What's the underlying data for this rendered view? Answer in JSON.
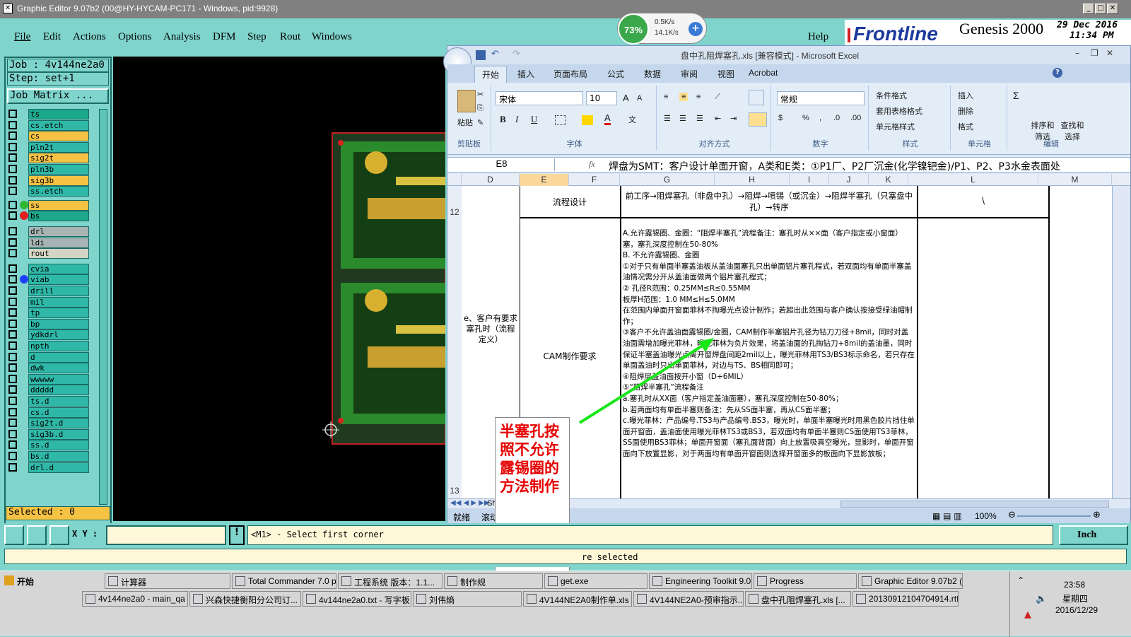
{
  "window": {
    "title": "Graphic Editor 9.07b2 (00@HY-HYCAM-PC171 - Windows, pid:9928)"
  },
  "menu": {
    "items": [
      "File",
      "Edit",
      "Actions",
      "Options",
      "Analysis",
      "DFM",
      "Step",
      "Rout",
      "Windows"
    ],
    "help": "Help"
  },
  "net": {
    "percent": "73%",
    "up": "0.5K/s",
    "down": "14.1K/s"
  },
  "brand": {
    "logo": "Frontline",
    "product": "Genesis 2000",
    "date": "29 Dec 2016",
    "time": "11:34 PM"
  },
  "job": {
    "name": "Job : 4v144ne2a0",
    "step": "Step: set+1",
    "matrix": "Job Matrix ...",
    "selected": "Selected : 0"
  },
  "layers": [
    "ts",
    "cs.etch",
    "cs",
    "pln2t",
    "sig2t",
    "pln3b",
    "sig3b",
    "ss.etch",
    "ss",
    "bs",
    "drl",
    "ldi",
    "rout",
    "cvia",
    "viab",
    "drill",
    "mil",
    "tp",
    "bp",
    "ydkdrl",
    "npth",
    "d",
    "dwk",
    "wwwww",
    "ddddd",
    "ts.d",
    "cs.d",
    "sig2t.d",
    "sig3b.d",
    "ss.d",
    "bs.d",
    "drl.d"
  ],
  "layer_colors": {
    "ts": "#1ca88a",
    "cs.etch": "#2fb8a8",
    "cs": "#f6c244",
    "pln2t": "#2fb8a8",
    "sig2t": "#f6c244",
    "pln3b": "#2fb8a8",
    "sig3b": "#f6c244",
    "ss.etch": "#2fb8a8",
    "ss": "#f6c244",
    "bs": "#1ca88a",
    "drl": "#a8b4b4",
    "ldi": "#a8b4b4",
    "rout": "#d4d4c4"
  },
  "excel": {
    "title": "盘中孔阻焊塞孔.xls [兼容模式] - Microsoft Excel",
    "tabs": [
      "开始",
      "插入",
      "页面布局",
      "公式",
      "数据",
      "审阅",
      "视图",
      "Acrobat"
    ],
    "groups": [
      "剪贴板",
      "字体",
      "对齐方式",
      "数字",
      "样式",
      "单元格",
      "编辑"
    ],
    "paste": "粘贴",
    "font_name": "宋体",
    "font_size": "10",
    "number_format": "常规",
    "style_buttons": [
      "条件格式",
      "套用表格格式",
      "单元格样式"
    ],
    "cell_buttons": [
      "插入",
      "删除",
      "格式"
    ],
    "edit_buttons": [
      "排序和筛选",
      "查找和选择"
    ],
    "name_box": "E8",
    "fx": "fx",
    "formula": "焊盘为SMT：客户设计单面开窗，A类和E类：①P1厂、P2厂沉金(化学镍钯金)/P1、P2、P3水金表面处",
    "columns": [
      "D",
      "E",
      "F",
      "G",
      "H",
      "I",
      "J",
      "K",
      "L",
      "M"
    ],
    "rows": [
      "12",
      "13"
    ],
    "row12_label": "流程设计",
    "row12_flow": "前工序→阻焊塞孔（非盘中孔）→阻焊→喷锡（或沉金）→阻焊半塞孔（只塞盘中孔）→转序",
    "row12_l": "\\",
    "row13_category": "e、客户有要求塞孔时（流程定义）",
    "row13_label": "CAM制作要求",
    "row13_text": [
      "A.允许露锡圈、金圈：“阻焊半塞孔”流程备注：塞孔时从××面（客户指定或小窗面）塞，塞孔深度控制在50-80%",
      "B. 不允许露锡圈、金圈",
      "①对于只有单面半塞盖油板从盖油面塞孔只出单面铝片塞孔程式，若双面均有单面半塞盖油情况需分开从盖油面做两个铝片塞孔程式；",
      "②  孔径R范围：0.25MM≤R≤0.55MM",
      "    板厚H范围：1.0 MM≤H≤5.0MM",
      "在范围内单面开窗面菲林不掏曝光点设计制作；若超出此范围与客户确认按接受绿油帽制作；",
      "③客户不允许盖油面露锡圈/金圈，CAM制作半塞铝片孔径为钻刀刀径+8mil，同时对盖油面需增加曝光菲林，曝光菲林为负片效果，将盖油面的孔掏钻刀+8mil的盖油墨，同时保证半塞盖油曝光点离开窗焊盘间距2mil以上，曝光菲林用TS3/BS3标示命名，若只存在单面盖油时只出单面菲林，对边与TS、BS相同即可；",
      "④阻焊层盖油面按开小窗（D+6MIL）",
      "⑤“阻焊半塞孔”流程备注",
      "a.塞孔时从XX面（客户指定盖油面塞），塞孔深度控制在50-80%；",
      "b.若两面均有单面半塞则备注：先从SS面半塞，再从CS面半塞；",
      "c.曝光菲林：产品编号.TS3与产品编号.BS3，曝光时，单面半塞曝光时用黑色胶片挡住单面开窗面，盖油面使用曝光菲林TS3或BS3，若双面均有单面半塞则CS面使用TS3菲林，SS面使用BS3菲林；单面开窗面（塞孔面背面）向上放置吸真空曝光，显影时，单面开窗面向下放置显影，对于两面均有单面开窗面则选择开窗面多的板面向下显影放板；"
    ],
    "sheet": "Sheet",
    "status": [
      "就绪",
      "滚动"
    ],
    "zoom": "100%"
  },
  "annotation": {
    "text": "半塞孔按照不允许露锡圈的方法制作",
    "arrow_color": "#19e619"
  },
  "cmd": {
    "xy_label": "X Y :",
    "prompt": "<M1> - Select first corner",
    "unit": "Inch"
  },
  "msg": {
    "text": "re selected"
  },
  "taskbar": {
    "start": "开始",
    "row1": [
      "计算器",
      "Total Commander 7.0 p...",
      "工程系统  版本：1.1...",
      "制作规",
      "get.exe",
      "Engineering Toolkit 9.0...",
      "Progress",
      "Graphic Editor 9.07b2 (..."
    ],
    "row2": [
      "4v144ne2a0 - main_qa",
      "兴森快捷衡阳分公司订...",
      "4v144ne2a0.txt - 写字板",
      "刘伟熵",
      "4V144NE2A0制作单.xls ...",
      "4V144NE2A0-预审指示...",
      "盘中孔阻焊塞孔.xls [...",
      "20130912104704914.rtf..."
    ],
    "clock_time": "23:58",
    "clock_day": "星期四",
    "clock_date": "2016/12/29"
  }
}
